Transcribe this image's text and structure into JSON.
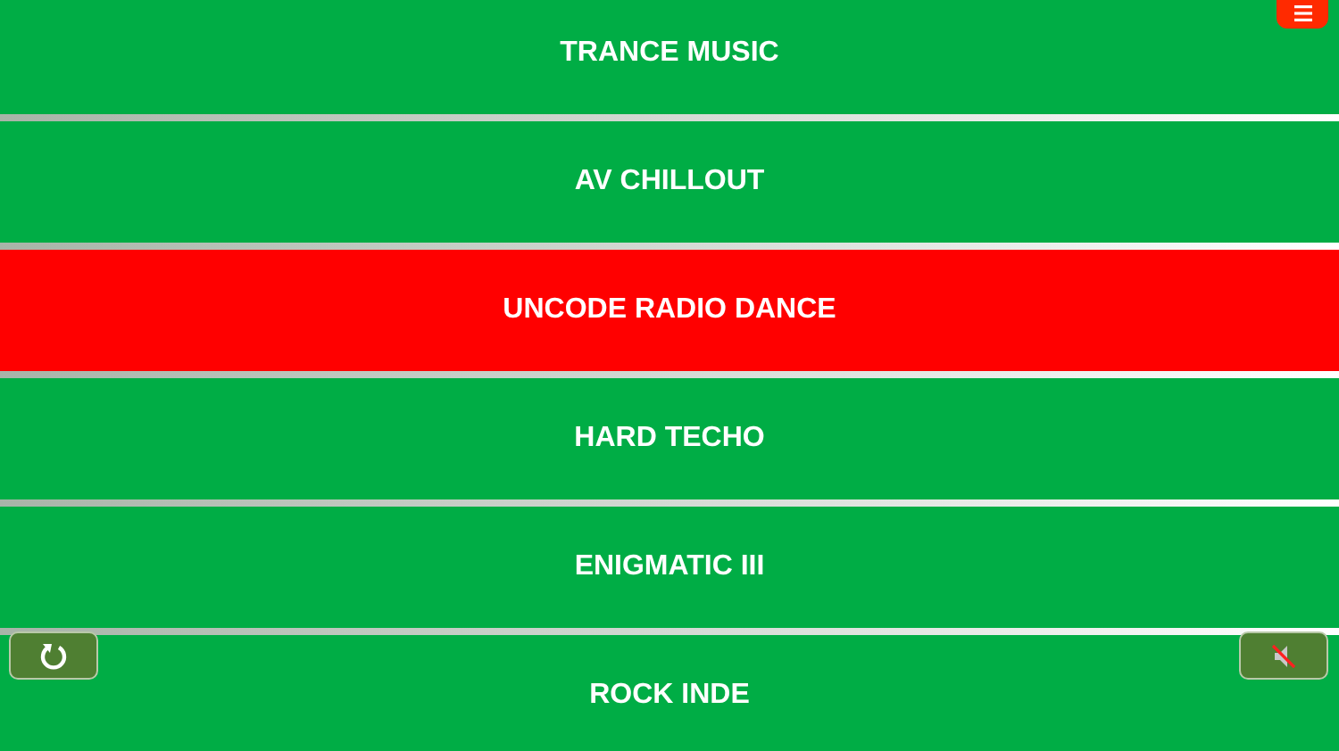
{
  "stations": [
    {
      "name": "TRANCE MUSIC",
      "selected": false
    },
    {
      "name": "AV CHILLOUT",
      "selected": false
    },
    {
      "name": "UNCODE RADIO DANCE",
      "selected": true
    },
    {
      "name": "HARD TECHO",
      "selected": false
    },
    {
      "name": "ENIGMATIC III",
      "selected": false
    },
    {
      "name": "ROCK INDE",
      "selected": false
    }
  ],
  "controls": {
    "muted": true
  }
}
